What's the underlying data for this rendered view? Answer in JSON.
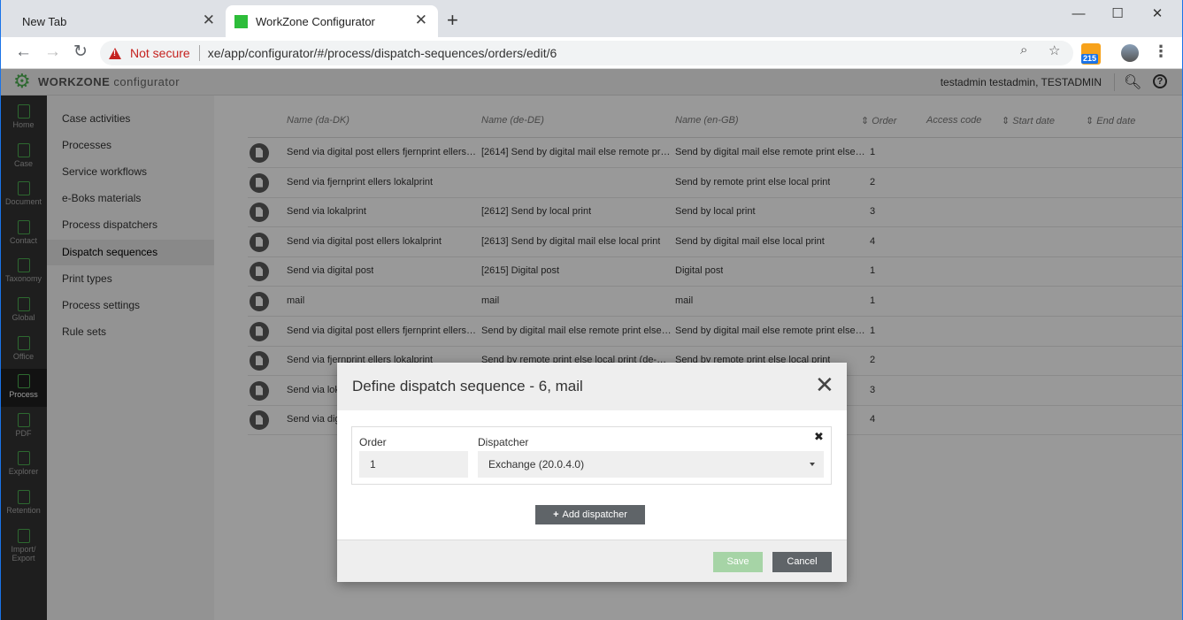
{
  "browser": {
    "tabs": [
      {
        "title": "New Tab",
        "active": false
      },
      {
        "title": "WorkZone Configurator",
        "active": true
      }
    ],
    "security_label": "Not secure",
    "url": "xe/app/configurator/#/process/dispatch-sequences/orders/edit/6",
    "extension_badge": "215",
    "icons": {
      "back": "arrow-left-icon",
      "forward": "arrow-right-icon",
      "reload": "reload-icon",
      "zoom": "zoom-icon",
      "star": "bookmark-star-icon",
      "menu": "kebab-menu-icon"
    },
    "colors": {
      "tabbar": "#dee1e6",
      "warning": "#c5221f",
      "favicon": "#2dbd3a"
    }
  },
  "app": {
    "logo_main": "WORKZONE",
    "logo_sub": " configurator",
    "user": "testadmin testadmin, TESTADMIN",
    "accent": "#4caf50",
    "rail": [
      {
        "label": "Home"
      },
      {
        "label": "Case"
      },
      {
        "label": "Document"
      },
      {
        "label": "Contact"
      },
      {
        "label": "Taxonomy"
      },
      {
        "label": "Global"
      },
      {
        "label": "Office"
      },
      {
        "label": "Process"
      },
      {
        "label": "PDF"
      },
      {
        "label": "Explorer"
      },
      {
        "label": "Retention"
      },
      {
        "label": "Import/ Export"
      }
    ],
    "active_rail": "Process",
    "subnav": [
      {
        "label": "Case activities"
      },
      {
        "label": "Processes"
      },
      {
        "label": "Service workflows"
      },
      {
        "label": "e-Boks materials"
      },
      {
        "label": "Process dispatchers"
      },
      {
        "label": "Dispatch sequences"
      },
      {
        "label": "Print types"
      },
      {
        "label": "Process settings"
      },
      {
        "label": "Rule sets"
      }
    ],
    "active_subnav": "Dispatch sequences"
  },
  "table": {
    "columns": {
      "da": "Name (da-DK)",
      "de": "Name (de-DE)",
      "en": "Name (en-GB)",
      "order": "Order",
      "access": "Access code",
      "start": "Start date",
      "end": "End date"
    },
    "rows": [
      {
        "da": "Send via digital post ellers fjernprint ellers …",
        "de": "[2614] Send by digital mail else remote pri…",
        "en": "Send by digital mail else remote print else …",
        "order": "1"
      },
      {
        "da": "Send via fjernprint ellers lokalprint",
        "de": "",
        "en": "Send by remote print else local print",
        "order": "2"
      },
      {
        "da": "Send via lokalprint",
        "de": "[2612] Send by local print",
        "en": "Send by local print",
        "order": "3"
      },
      {
        "da": "Send via digital post ellers lokalprint",
        "de": "[2613] Send by digital mail else local print",
        "en": "Send by digital mail else local print",
        "order": "4"
      },
      {
        "da": "Send via digital post",
        "de": "[2615] Digital post",
        "en": "Digital post",
        "order": "1"
      },
      {
        "da": "mail",
        "de": "mail",
        "en": "mail",
        "order": "1"
      },
      {
        "da": "Send via digital post ellers fjernprint ellers …",
        "de": "Send by digital mail else remote print else …",
        "en": "Send by digital mail else remote print else …",
        "order": "1"
      },
      {
        "da": "Send via fjernprint ellers lokalprint",
        "de": "Send by remote print else local print (de-D…",
        "en": "Send by remote print else local print",
        "order": "2"
      },
      {
        "da": "Send via lok",
        "de": "",
        "en": "",
        "order": "3"
      },
      {
        "da": "Send via dig",
        "de": "",
        "en": "",
        "order": "4"
      }
    ]
  },
  "modal": {
    "title": "Define dispatch sequence - 6, mail",
    "order_label": "Order",
    "order_value": "1",
    "dispatcher_label": "Dispatcher",
    "dispatcher_value": "Exchange (20.0.4.0)",
    "add_label": "Add dispatcher",
    "save_label": "Save",
    "cancel_label": "Cancel",
    "colors": {
      "save": "#a6d4a6",
      "secondary": "#5f6468"
    }
  }
}
